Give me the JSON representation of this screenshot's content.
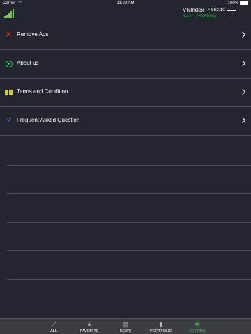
{
  "status_bar": {
    "carrier": "Carrier",
    "wifi_icon": "wifi-icon",
    "time": "11:29 AM",
    "battery": "100%"
  },
  "header": {
    "logo_icon": "bar-chart-logo",
    "ticker": {
      "name": "VNIndex",
      "arrow": "▲",
      "price": "562.10",
      "change": "3.43",
      "change_pct": "(+0.610%)"
    },
    "menu_icon": "list-icon"
  },
  "menu": {
    "items": [
      {
        "label": "Remove Ads",
        "icon": "remove-x-icon",
        "color": "#e02424"
      },
      {
        "label": "About us",
        "icon": "about-icon",
        "color": "#3cc84a"
      },
      {
        "label": "Terms and Condition",
        "icon": "book-icon",
        "color": "#d8d020"
      },
      {
        "label": "Frequent Asked Question",
        "icon": "question-icon",
        "color": "#3a78e0"
      }
    ]
  },
  "tabs": [
    {
      "label": "ALL",
      "icon": "chart-icon",
      "active": false
    },
    {
      "label": "FAVORITE",
      "icon": "star-icon",
      "active": false
    },
    {
      "label": "NEWS",
      "icon": "newspaper-icon",
      "active": false
    },
    {
      "label": "PORTFOLIO",
      "icon": "portfolio-icon",
      "active": false
    },
    {
      "label": "SETTING",
      "icon": "gear-icon",
      "active": true
    }
  ],
  "colors": {
    "background": "#23262f",
    "accent": "#3cc84a",
    "tab_bar": "#3b3d42"
  }
}
